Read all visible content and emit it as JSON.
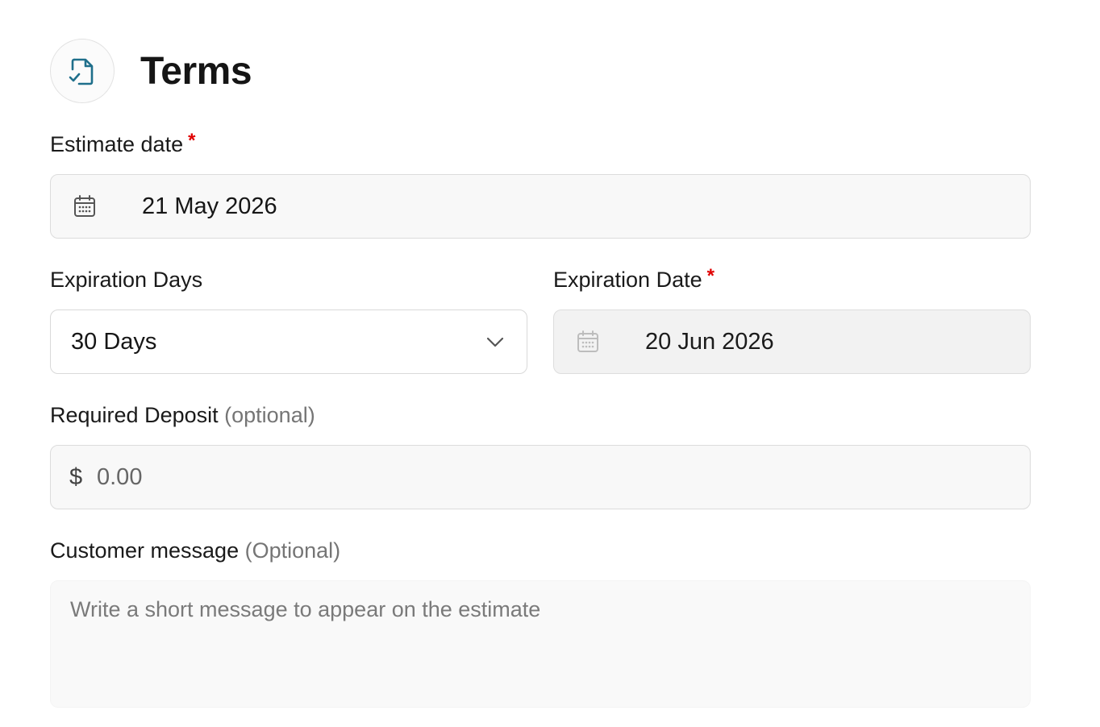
{
  "section": {
    "icon": "document-check-icon",
    "title": "Terms"
  },
  "estimate_date": {
    "label": "Estimate date",
    "required_mark": "*",
    "icon": "calendar-icon",
    "value": "21 May 2026"
  },
  "expiration_days": {
    "label": "Expiration Days",
    "value": "30 Days",
    "icon": "chevron-down-icon"
  },
  "expiration_date": {
    "label": "Expiration Date",
    "required_mark": "*",
    "icon": "calendar-icon",
    "value": "20 Jun 2026"
  },
  "required_deposit": {
    "label": "Required Deposit",
    "optional_text": "(optional)",
    "currency": "$",
    "value": "0.00"
  },
  "customer_message": {
    "label": "Customer message",
    "optional_text": "(Optional)",
    "placeholder": "Write a short message to appear on the estimate"
  },
  "colors": {
    "accent": "#1f6f8b",
    "required": "#e00000"
  }
}
